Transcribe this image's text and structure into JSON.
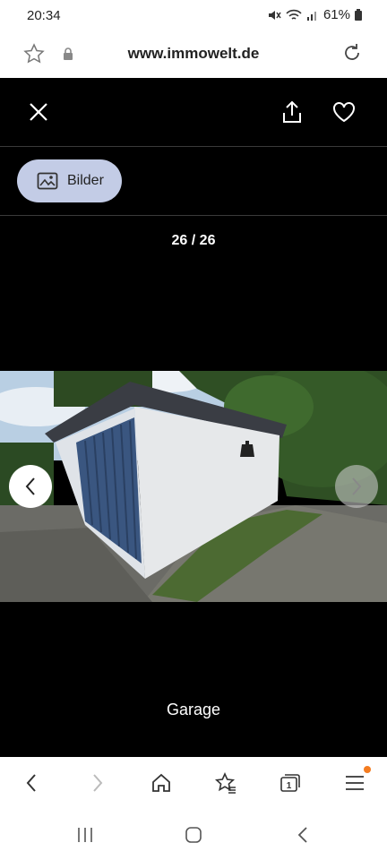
{
  "status_bar": {
    "time": "20:34",
    "battery": "61%"
  },
  "browser": {
    "url": "www.immowelt.de"
  },
  "gallery": {
    "filter_label": "Bilder",
    "counter": "26 / 26",
    "caption": "Garage",
    "tab_count": "1"
  },
  "colors": {
    "chip_bg": "#c3cce6",
    "notification_dot": "#f47c20",
    "garage_door": "#3a5680"
  }
}
